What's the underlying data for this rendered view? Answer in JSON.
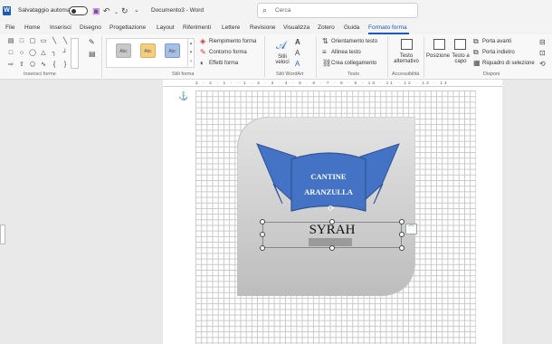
{
  "titlebar": {
    "autosave_label": "Salvataggio automatico",
    "document_title": "Documento3 - Word",
    "search_placeholder": "Cerca"
  },
  "tabs": [
    {
      "label": "File"
    },
    {
      "label": "Home"
    },
    {
      "label": "Inserisci"
    },
    {
      "label": "Disegno"
    },
    {
      "label": "Progettazione"
    },
    {
      "label": "Layout"
    },
    {
      "label": "Riferimenti"
    },
    {
      "label": "Lettere"
    },
    {
      "label": "Revisione"
    },
    {
      "label": "Visualizza"
    },
    {
      "label": "Zotero"
    },
    {
      "label": "Guida"
    },
    {
      "label": "Formato forma",
      "active": true
    }
  ],
  "ribbon": {
    "groups": {
      "insert_shapes": "Inserisci forme",
      "shape_styles": "Stili forma",
      "wordart_styles": "Stili WordArt",
      "text": "Testo",
      "accessibility": "Accessibilità",
      "arrange": "Disponi"
    },
    "style_swatch_label": "Abc",
    "shape_fill": "Riempimento forma",
    "shape_outline": "Contorno forma",
    "shape_effects": "Effetti forma",
    "quick_styles": "Stili veloci",
    "text_direction": "Orientamento testo",
    "align_text": "Allinea testo",
    "create_link": "Crea collegamento",
    "alt_text": "Testo alternativo",
    "position": "Posizione",
    "wrap_text": "Testo a capo",
    "bring_forward": "Porta avanti",
    "send_backward": "Porta indietro",
    "selection_pane": "Riquadro di selezione"
  },
  "ruler_ticks": "3 · 2 · 1 · · 1 · 2 · 3 · 4 · 5 · 6 · 7 · 8 · 9 · 10 · 11 · 12 · 13 · 14",
  "document": {
    "banner_line1": "CANTINE",
    "banner_line2": "ARANZULLA",
    "textbox_text": "SYRAH"
  },
  "colors": {
    "accent": "#185abd",
    "banner": "#4472c4",
    "banner_dark": "#2f5597",
    "label_bg": "#c8c8c8"
  }
}
